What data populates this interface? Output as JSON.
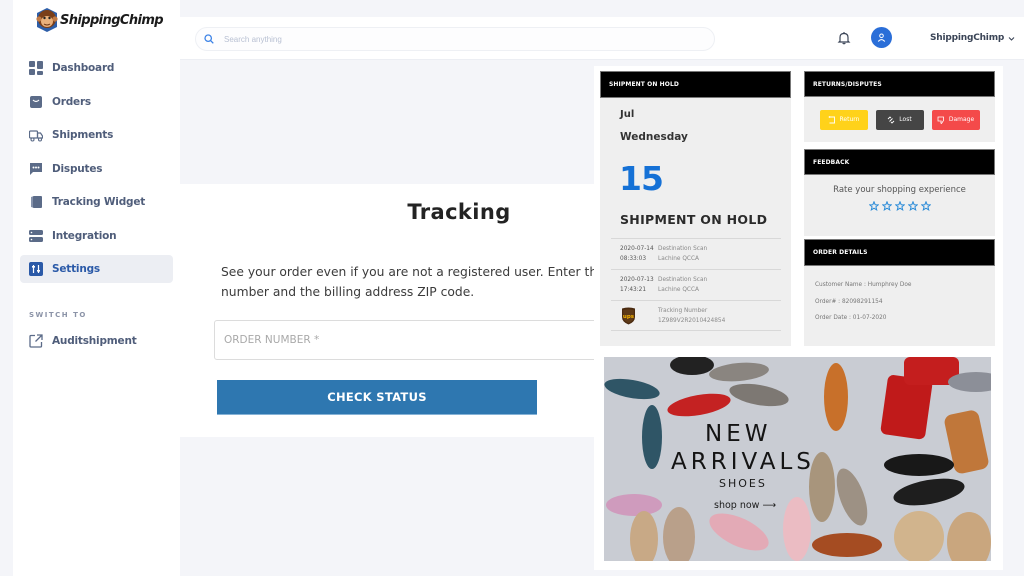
{
  "app": {
    "brand_name": "ShippingChimp"
  },
  "sidebar": {
    "items": [
      {
        "label": "Dashboard",
        "icon": "dashboard-icon"
      },
      {
        "label": "Orders",
        "icon": "orders-icon"
      },
      {
        "label": "Shipments",
        "icon": "truck-icon"
      },
      {
        "label": "Disputes",
        "icon": "chat-icon"
      },
      {
        "label": "Tracking Widget",
        "icon": "widget-icon"
      },
      {
        "label": "Integration",
        "icon": "server-icon"
      },
      {
        "label": "Settings",
        "icon": "sliders-icon",
        "active": true
      }
    ],
    "switch_title": "SWITCH TO",
    "switch_items": [
      {
        "label": "Auditshipment",
        "icon": "external-link-icon"
      }
    ]
  },
  "topbar": {
    "search_placeholder": "Search anything",
    "search_value": "",
    "user_name": "ShippingChimp"
  },
  "tracking": {
    "title": "Tracking",
    "description_line1": "See your order even if you are not a registered user. Enter the order",
    "description_line2": "number and the billing address ZIP code.",
    "order_placeholder": "ORDER NUMBER *",
    "order_value": "",
    "button_label": "CHECK STATUS"
  },
  "widget": {
    "hold": {
      "header": "SHIPMENT ON HOLD",
      "month": "Jul",
      "weekday": "Wednesday",
      "day": "15",
      "status": "SHIPMENT ON HOLD",
      "events": [
        {
          "date": "2020-07-14",
          "time": "08:33:03",
          "event": "Destination Scan",
          "location": "Lachine QCCA"
        },
        {
          "date": "2020-07-13",
          "time": "17:43:21",
          "event": "Destination Scan",
          "location": "Lachine QCCA"
        }
      ],
      "carrier": "UPS",
      "tracking_label": "Tracking Number",
      "tracking_number": "1Z989V2R2010424854"
    },
    "returns": {
      "header": "RETURNS/DISPUTES",
      "buttons": [
        {
          "label": "Return",
          "color": "#ffd21a"
        },
        {
          "label": "Lost",
          "color": "#454545"
        },
        {
          "label": "Damage",
          "color": "#f44a4a"
        }
      ]
    },
    "feedback": {
      "header": "FEEDBACK",
      "prompt": "Rate your shopping experience",
      "rating": 0,
      "max_rating": 5
    },
    "order_details": {
      "header": "ORDER DETAILS",
      "customer": "Customer Name : Humphrey Doe",
      "order_no": "Order# : 82098291154",
      "order_date": "Order Date : 01-07-2020"
    },
    "banner": {
      "line1": "NEW",
      "line2": "ARRIVALS",
      "line3": "SHOES",
      "cta": "shop now ⟶"
    }
  },
  "colors": {
    "accent": "#2e77b0",
    "date_blue": "#1571d6",
    "avatar": "#2a6ed8",
    "nav_text": "#4f5d7a",
    "active_nav_text": "#2b5aa8"
  }
}
